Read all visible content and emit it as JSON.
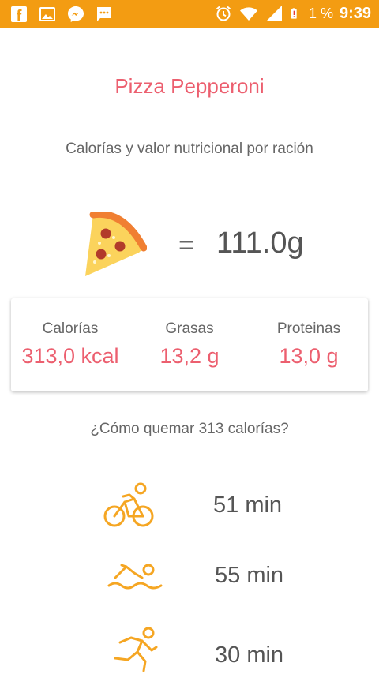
{
  "status_bar": {
    "battery_percent": "1 %",
    "time": "9:39",
    "icons": [
      "facebook-icon",
      "gallery-icon",
      "messenger-icon",
      "message-icon",
      "alarm-icon",
      "wifi-icon",
      "signal-icon",
      "battery-alert-icon"
    ]
  },
  "food": {
    "title": "Pizza Pepperoni",
    "subtitle": "Calorías y valor nutricional por ración",
    "equals": "=",
    "weight": "111.0g",
    "icon": "pizza-slice-icon"
  },
  "nutrition": {
    "calories": {
      "label": "Calorías",
      "value": "313,0 kcal"
    },
    "fat": {
      "label": "Grasas",
      "value": "13,2 g"
    },
    "protein": {
      "label": "Proteinas",
      "value": "13,0 g"
    }
  },
  "burn": {
    "question": "¿Cómo quemar 313 calorías?",
    "activities": [
      {
        "icon": "cycling-icon",
        "duration": "51 min"
      },
      {
        "icon": "swimming-icon",
        "duration": "55 min"
      },
      {
        "icon": "running-icon",
        "duration": "30 min"
      }
    ]
  },
  "colors": {
    "status_bar": "#f39c12",
    "accent": "#ec5f6f",
    "activity_icon": "#f5a623"
  }
}
